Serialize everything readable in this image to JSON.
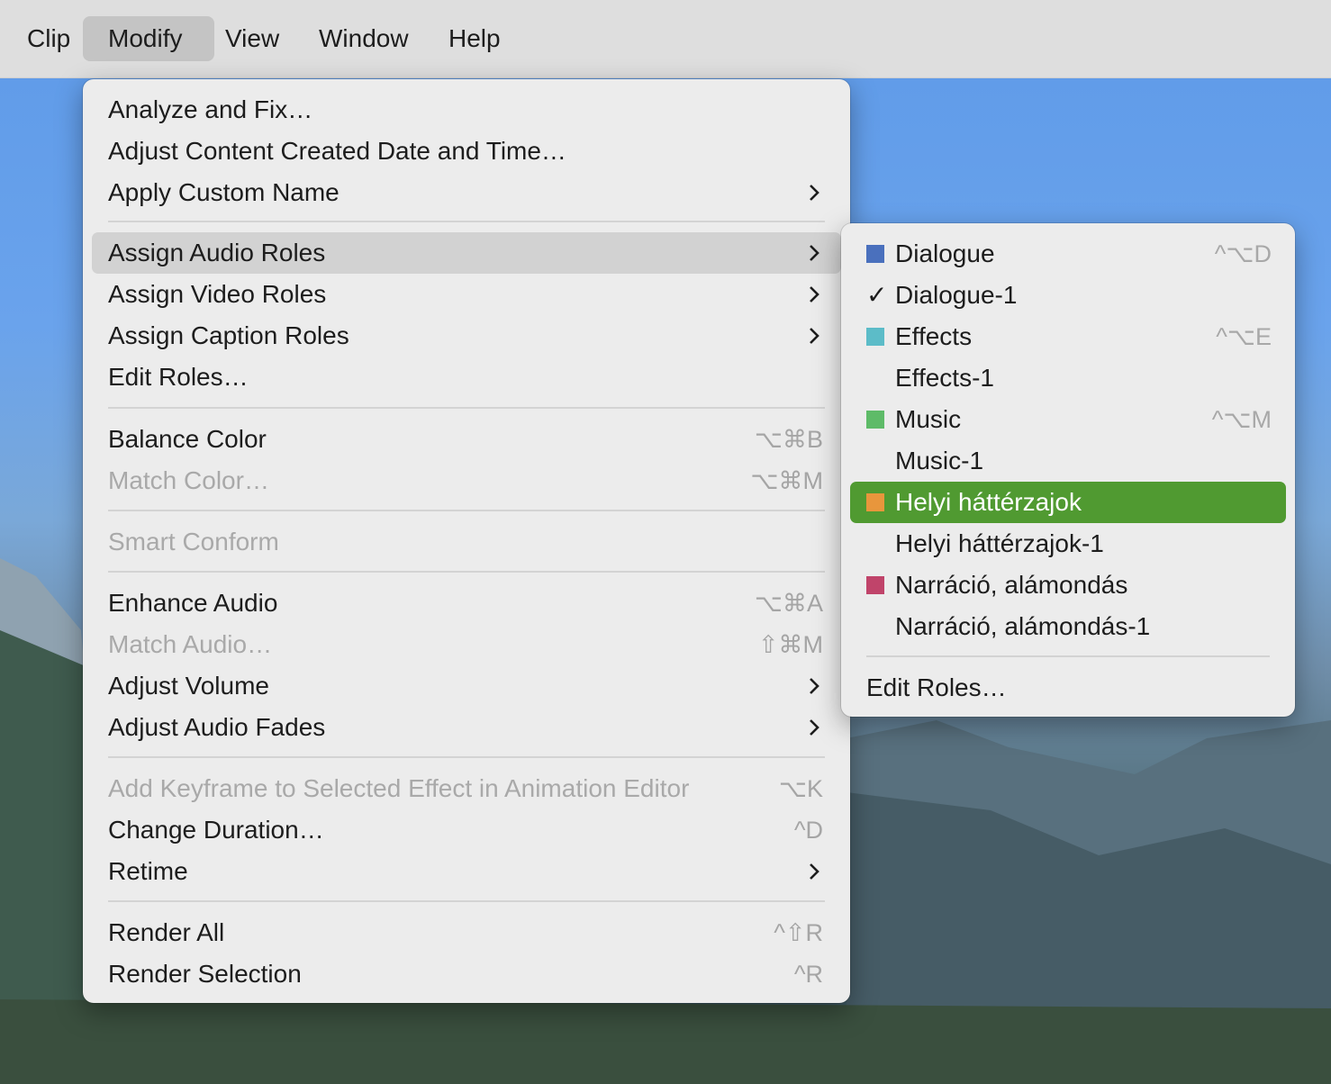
{
  "menubar": {
    "items": [
      "Clip",
      "Modify",
      "View",
      "Window",
      "Help"
    ],
    "active": "Modify"
  },
  "modify_menu": {
    "items": [
      {
        "label": "Analyze and Fix…",
        "shortcut": "",
        "submenu": false,
        "disabled": false
      },
      {
        "label": "Adjust Content Created Date and Time…",
        "shortcut": "",
        "submenu": false,
        "disabled": false
      },
      {
        "label": "Apply Custom Name",
        "shortcut": "",
        "submenu": true,
        "disabled": false
      },
      {
        "label": "Assign Audio Roles",
        "shortcut": "",
        "submenu": true,
        "disabled": false,
        "highlighted": true
      },
      {
        "label": "Assign Video Roles",
        "shortcut": "",
        "submenu": true,
        "disabled": false
      },
      {
        "label": "Assign Caption Roles",
        "shortcut": "",
        "submenu": true,
        "disabled": false
      },
      {
        "label": "Edit Roles…",
        "shortcut": "",
        "submenu": false,
        "disabled": false
      },
      {
        "label": "Balance Color",
        "shortcut": "⌥⌘B",
        "submenu": false,
        "disabled": false
      },
      {
        "label": "Match Color…",
        "shortcut": "⌥⌘M",
        "submenu": false,
        "disabled": true
      },
      {
        "label": "Smart Conform",
        "shortcut": "",
        "submenu": false,
        "disabled": true
      },
      {
        "label": "Enhance Audio",
        "shortcut": "⌥⌘A",
        "submenu": false,
        "disabled": false
      },
      {
        "label": "Match Audio…",
        "shortcut": "⇧⌘M",
        "submenu": false,
        "disabled": true
      },
      {
        "label": "Adjust Volume",
        "shortcut": "",
        "submenu": true,
        "disabled": false
      },
      {
        "label": "Adjust Audio Fades",
        "shortcut": "",
        "submenu": true,
        "disabled": false
      },
      {
        "label": "Add Keyframe to Selected Effect in Animation Editor",
        "shortcut": "⌥K",
        "submenu": false,
        "disabled": true
      },
      {
        "label": "Change Duration…",
        "shortcut": "^D",
        "submenu": false,
        "disabled": false
      },
      {
        "label": "Retime",
        "shortcut": "",
        "submenu": true,
        "disabled": false
      },
      {
        "label": "Render All",
        "shortcut": "^⇧R",
        "submenu": false,
        "disabled": false
      },
      {
        "label": "Render Selection",
        "shortcut": "^R",
        "submenu": false,
        "disabled": false
      }
    ]
  },
  "audio_roles_submenu": {
    "items": [
      {
        "label": "Dialogue",
        "shortcut": "^⌥D",
        "swatch": "#4a70bd",
        "checked": false,
        "selected": false
      },
      {
        "label": "Dialogue-1",
        "shortcut": "",
        "swatch": "",
        "checked": true,
        "selected": false
      },
      {
        "label": "Effects",
        "shortcut": "^⌥E",
        "swatch": "#5cbcc8",
        "checked": false,
        "selected": false
      },
      {
        "label": "Effects-1",
        "shortcut": "",
        "swatch": "",
        "checked": false,
        "selected": false
      },
      {
        "label": "Music",
        "shortcut": "^⌥M",
        "swatch": "#5ebb68",
        "checked": false,
        "selected": false
      },
      {
        "label": "Music-1",
        "shortcut": "",
        "swatch": "",
        "checked": false,
        "selected": false
      },
      {
        "label": "Helyi háttérzajok",
        "shortcut": "",
        "swatch": "#e8963c",
        "checked": false,
        "selected": true
      },
      {
        "label": "Helyi háttérzajok-1",
        "shortcut": "",
        "swatch": "",
        "checked": false,
        "selected": false
      },
      {
        "label": "Narráció, alámondás",
        "shortcut": "",
        "swatch": "#c0446a",
        "checked": false,
        "selected": false
      },
      {
        "label": "Narráció, alámondás-1",
        "shortcut": "",
        "swatch": "",
        "checked": false,
        "selected": false
      }
    ],
    "footer": {
      "label": "Edit Roles…"
    },
    "check_glyph": "✓",
    "selection_color": "#509a31"
  }
}
